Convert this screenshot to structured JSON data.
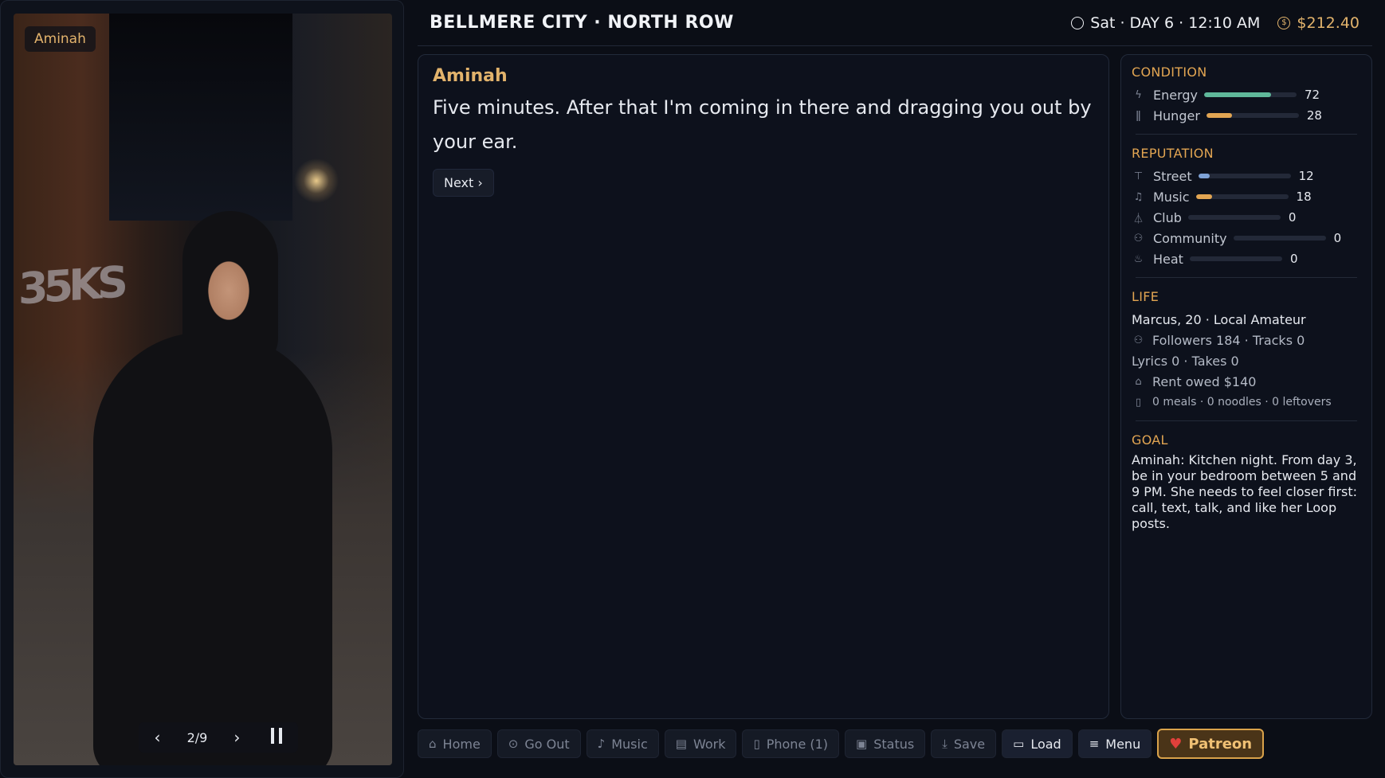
{
  "portrait": {
    "character_name": "Aminah",
    "gallery_counter": "2/9",
    "graffiti_text": "35KS"
  },
  "header": {
    "location": "BELLMERE CITY · NORTH ROW",
    "time": "Sat · DAY 6 · 12:10 AM",
    "money": "$212.40"
  },
  "dialogue": {
    "speaker": "Aminah",
    "line": "Five minutes. After that I'm coming in there and dragging you out by your ear.",
    "next_label": "Next ›"
  },
  "sidebar": {
    "condition": {
      "title": "CONDITION",
      "stats": [
        {
          "label": "Energy",
          "value": 72,
          "icon": "lightning-icon",
          "color": "#5fb89a"
        },
        {
          "label": "Hunger",
          "value": 28,
          "icon": "utensils-icon",
          "color": "#e2a552"
        }
      ]
    },
    "reputation": {
      "title": "REPUTATION",
      "stats": [
        {
          "label": "Street",
          "value": 12,
          "icon": "signpost-icon",
          "color": "#7ea2d6"
        },
        {
          "label": "Music",
          "value": 18,
          "icon": "music-note-icon",
          "color": "#e2a552"
        },
        {
          "label": "Club",
          "value": 0,
          "icon": "flask-icon",
          "color": "#7d8494"
        },
        {
          "label": "Community",
          "value": 0,
          "icon": "people-icon",
          "color": "#7d8494"
        },
        {
          "label": "Heat",
          "value": 0,
          "icon": "flame-icon",
          "color": "#7d8494"
        }
      ]
    },
    "life": {
      "title": "LIFE",
      "identity": "Marcus, 20 · Local Amateur",
      "followers": "Followers 184 · Tracks 0",
      "lyrics": "Lyrics 0 · Takes 0",
      "rent": "Rent owed $140",
      "food": "0 meals · 0 noodles · 0 leftovers"
    },
    "goal": {
      "title": "GOAL",
      "text": "Aminah: Kitchen night. From day 3, be in your bedroom between 5 and 9 PM. She needs to feel closer first: call, text, talk, and like her Loop posts."
    }
  },
  "bottom_bar": {
    "home": "Home",
    "go_out": "Go Out",
    "music": "Music",
    "work": "Work",
    "phone": "Phone (1)",
    "status": "Status",
    "save": "Save",
    "load": "Load",
    "menu": "Menu",
    "patreon": "Patreon"
  },
  "colors": {
    "accent": "#e2b36c",
    "section_title": "#e2a552",
    "background": "#0b0e16"
  }
}
